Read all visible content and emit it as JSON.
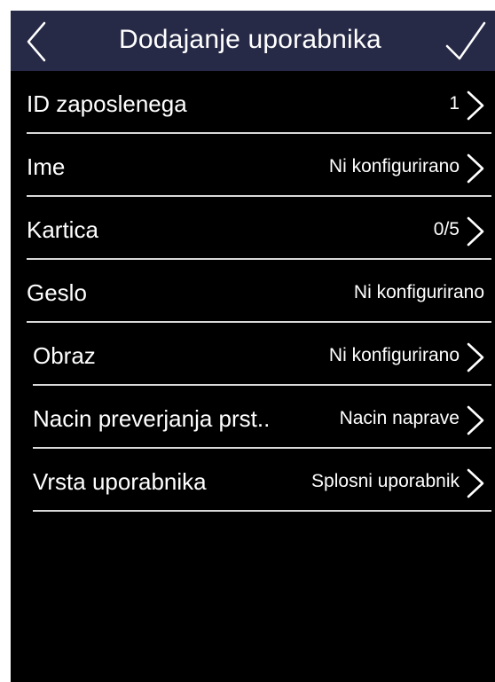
{
  "header": {
    "title": "Dodajanje uporabnika"
  },
  "rows": [
    {
      "label": "ID zaposlenega",
      "value": "1",
      "arrow": true
    },
    {
      "label": "Ime",
      "value": "Ni konfigurirano",
      "arrow": true
    },
    {
      "label": "Kartica",
      "value": "0/5",
      "arrow": true
    },
    {
      "label": "Geslo",
      "value": "Ni konfigurirano",
      "arrow": false
    },
    {
      "label": "Obraz",
      "value": "Ni konfigurirano",
      "arrow": true
    },
    {
      "label": "Nacin preverjanja prst..",
      "value": "Nacin naprave",
      "arrow": true
    },
    {
      "label": "Vrsta uporabnika",
      "value": "Splosni uporabnik",
      "arrow": true
    }
  ],
  "colors": {
    "header_bg": "#272a47",
    "screen_bg": "#000000",
    "divider": "#d9d9d9",
    "text": "#ffffff"
  },
  "icons": {
    "back": "chevron-left-icon",
    "confirm": "checkmark-icon",
    "row_arrow": "chevron-right-icon"
  }
}
